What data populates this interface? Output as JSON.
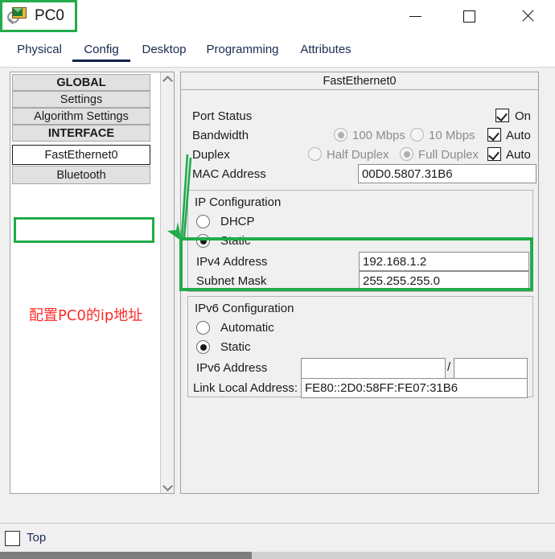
{
  "window": {
    "title": "PC0",
    "icon": "packet-tracer-inspect-icon",
    "minimize_label": "—",
    "maximize_label": "□",
    "close_label": "✕"
  },
  "tabs": [
    {
      "label": "Physical",
      "active": false
    },
    {
      "label": "Config",
      "active": true
    },
    {
      "label": "Desktop",
      "active": false
    },
    {
      "label": "Programming",
      "active": false
    },
    {
      "label": "Attributes",
      "active": false
    }
  ],
  "sidebar": {
    "items": [
      {
        "label": "GLOBAL",
        "type": "header",
        "selected": false
      },
      {
        "label": "Settings",
        "type": "item",
        "selected": false
      },
      {
        "label": "Algorithm Settings",
        "type": "item",
        "selected": false
      },
      {
        "label": "INTERFACE",
        "type": "header",
        "selected": false
      },
      {
        "label": "FastEthernet0",
        "type": "item",
        "selected": true
      },
      {
        "label": "Bluetooth",
        "type": "item",
        "selected": false
      }
    ],
    "scroll_up_icon": "chevron-up-icon",
    "scroll_down_icon": "chevron-down-icon"
  },
  "annotation": {
    "text": "配置PC0的ip地址",
    "color": "#ff2a2a",
    "highlight_color": "#22ab4b"
  },
  "panel": {
    "header": "FastEthernet0",
    "port_status": {
      "label": "Port Status",
      "on_label": "On",
      "on_checked": true
    },
    "bandwidth": {
      "label": "Bandwidth",
      "option_100": "100 Mbps",
      "option_10": "10 Mbps",
      "selected": "100 Mbps",
      "auto_label": "Auto",
      "auto_checked": true
    },
    "duplex": {
      "label": "Duplex",
      "option_half": "Half Duplex",
      "option_full": "Full Duplex",
      "selected": "Full Duplex",
      "auto_label": "Auto",
      "auto_checked": true
    },
    "mac": {
      "label": "MAC Address",
      "value": "00D0.5807.31B6"
    },
    "ip_config": {
      "legend": "IP Configuration",
      "dhcp_label": "DHCP",
      "static_label": "Static",
      "selected": "Static",
      "ipv4_label": "IPv4 Address",
      "ipv4_value": "192.168.1.2",
      "mask_label": "Subnet Mask",
      "mask_value": "255.255.255.0"
    },
    "ipv6_config": {
      "legend": "IPv6 Configuration",
      "automatic_label": "Automatic",
      "static_label": "Static",
      "selected": "Static",
      "ipv6_label": "IPv6 Address",
      "ipv6_value": "",
      "ipv6_prefix_value": "",
      "separator": "/",
      "link_local_label": "Link Local Address:",
      "link_local_value": "FE80::2D0:58FF:FE07:31B6"
    }
  },
  "bottom": {
    "top_label": "Top",
    "top_checked": false
  }
}
